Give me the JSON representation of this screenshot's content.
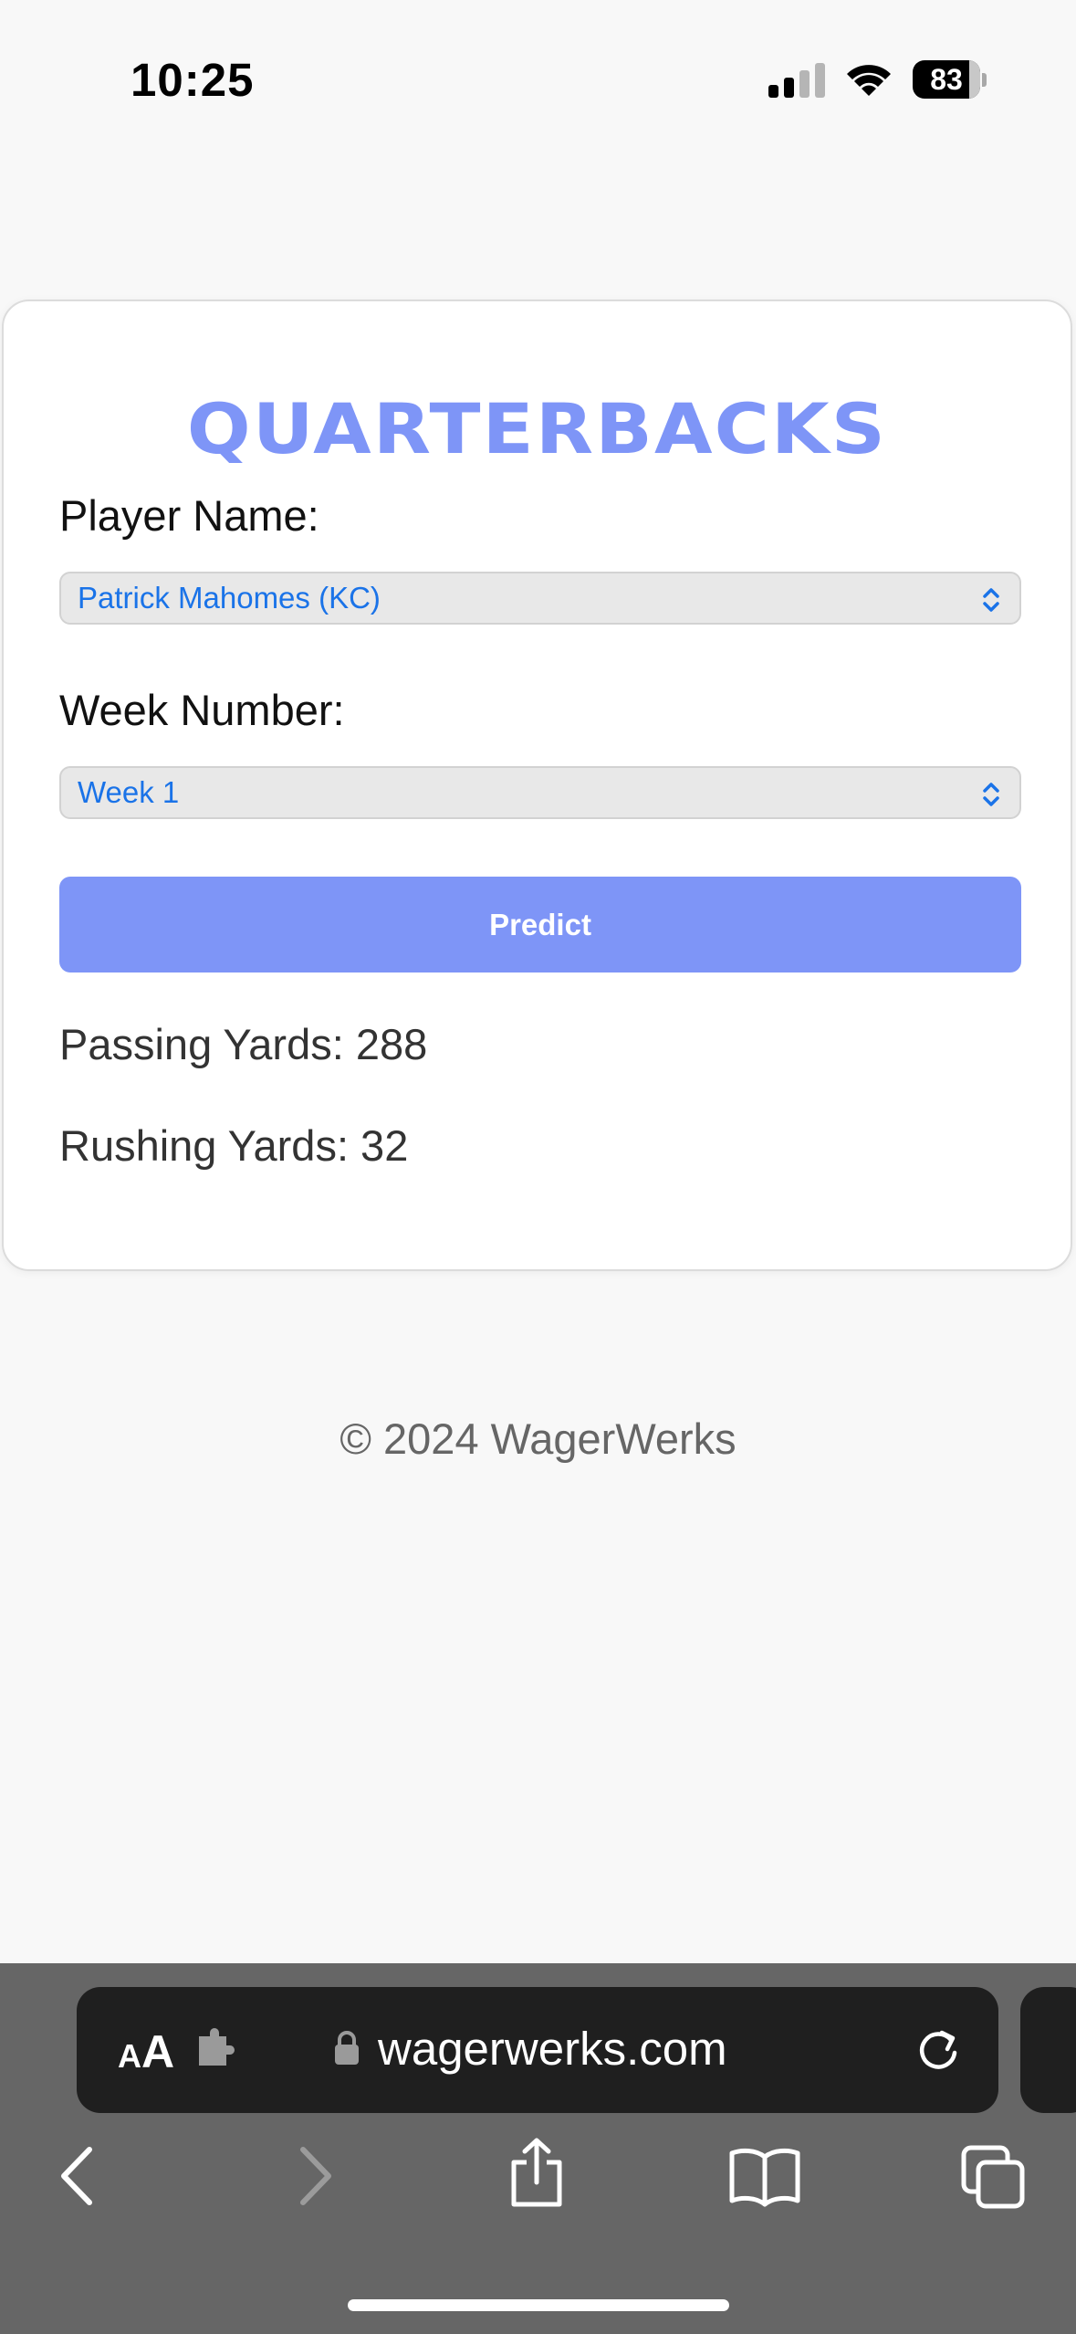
{
  "status_bar": {
    "time": "10:25",
    "battery": "83"
  },
  "card": {
    "title": "QUARTERBACKS",
    "player": {
      "label": "Player Name:",
      "selected": "Patrick Mahomes (KC)"
    },
    "week": {
      "label": "Week Number:",
      "selected": "Week 1"
    },
    "predict_label": "Predict",
    "results": {
      "passing": "Passing Yards: 288",
      "rushing": "Rushing Yards: 32"
    }
  },
  "footer": {
    "copyright": "© 2024 WagerWerks"
  },
  "browser": {
    "url": "wagerwerks.com",
    "aa_small": "A",
    "aa_large": "A"
  },
  "colors": {
    "accent": "#7e95f7",
    "select_text": "#1a73e8",
    "chrome_bg": "#666666"
  }
}
